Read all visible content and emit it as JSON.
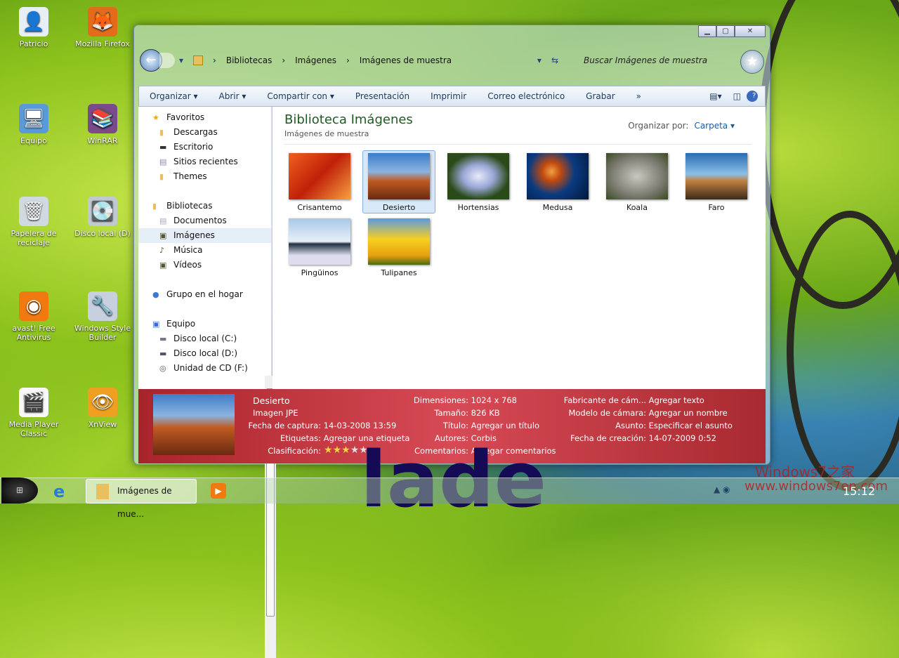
{
  "desktop": {
    "icons": [
      {
        "label": "Patricio",
        "glyph": "👤",
        "bg": "#e8eef5"
      },
      {
        "label": "Mozilla Firefox",
        "glyph": "🦊",
        "bg": "#e46b1a"
      },
      {
        "label": "Equipo",
        "glyph": "🖥",
        "bg": "#5a9ad8"
      },
      {
        "label": "WinRAR",
        "glyph": "📚",
        "bg": "#7a4a8a"
      },
      {
        "label": "Papelera de reciclaje",
        "glyph": "🗑",
        "bg": "#d0d8e0"
      },
      {
        "label": "Disco local (D)",
        "glyph": "💽",
        "bg": "#c0c8d0"
      },
      {
        "label": "avast! Free Antivirus",
        "glyph": "◉",
        "bg": "#f07a10"
      },
      {
        "label": "Windows Style Builder",
        "glyph": "🔧",
        "bg": "#c8d0e0"
      },
      {
        "label": "Media Player Classic",
        "glyph": "🎬",
        "bg": "#f8f8f8"
      },
      {
        "label": "XnView",
        "glyph": "👁",
        "bg": "#f0a020"
      }
    ]
  },
  "window": {
    "caption_buttons": [
      "▁",
      "▢",
      "✕"
    ],
    "breadcrumb": [
      "Bibliotecas",
      "Imágenes",
      "Imágenes de muestra"
    ],
    "search_placeholder": "Buscar Imágenes de muestra",
    "toolbar": [
      "Organizar ▾",
      "Abrir ▾",
      "Compartir con ▾",
      "Presentación",
      "Imprimir",
      "Correo electrónico",
      "Grabar",
      "»"
    ],
    "nav": [
      {
        "label": "Favoritos",
        "h": true,
        "icon": "★",
        "color": "#e8a820"
      },
      {
        "label": "Descargas",
        "icon": "▮",
        "color": "#e8c060"
      },
      {
        "label": "Escritorio",
        "icon": "▬",
        "color": "#333"
      },
      {
        "label": "Sitios recientes",
        "icon": "▤",
        "color": "#88a"
      },
      {
        "label": "Themes",
        "icon": "▮",
        "color": "#e8c060"
      },
      {
        "label": "",
        "spacer": true
      },
      {
        "label": "Bibliotecas",
        "h": true,
        "icon": "▮",
        "color": "#e8c060"
      },
      {
        "label": "Documentos",
        "icon": "▤",
        "color": "#aab"
      },
      {
        "label": "Imágenes",
        "icon": "▣",
        "color": "#553",
        "sel": true
      },
      {
        "label": "Música",
        "icon": "♪",
        "color": "#553"
      },
      {
        "label": "Vídeos",
        "icon": "▣",
        "color": "#553"
      },
      {
        "label": "",
        "spacer": true
      },
      {
        "label": "Grupo en el hogar",
        "h": true,
        "icon": "●",
        "color": "#3a7ad0"
      },
      {
        "label": "",
        "spacer": true
      },
      {
        "label": "Equipo",
        "h": true,
        "icon": "▣",
        "color": "#3a6ad0"
      },
      {
        "label": "Disco local (C:)",
        "icon": "▬",
        "color": "#778"
      },
      {
        "label": "Disco local (D:)",
        "icon": "▬",
        "color": "#556"
      },
      {
        "label": "Unidad de CD (F:)",
        "icon": "◎",
        "color": "#556"
      }
    ],
    "library_title": "Biblioteca Imágenes",
    "library_subtitle": "Imágenes de muestra",
    "arrange_label": "Organizar por:",
    "arrange_value": "Carpeta ▾",
    "items": [
      {
        "name": "Crisantemo",
        "bg": "linear-gradient(135deg,#f06020,#c02008,#f8a040)"
      },
      {
        "name": "Desierto",
        "bg": "linear-gradient(#3e7bc8,#8ab4e0 40%,#c05a22 60%,#6a2a10)",
        "selected": true
      },
      {
        "name": "Hortensias",
        "bg": "radial-gradient(#e8eaf8,#9aa8d8 35%,#2a4a18 70%)"
      },
      {
        "name": "Medusa",
        "bg": "radial-gradient(circle at 40% 40%,#f0a040,#c04a10 20%,#0a3a80 50%,#04183a)"
      },
      {
        "name": "Koala",
        "bg": "radial-gradient(#c8c8c0,#7a7a70 60%,#3a4a20)"
      },
      {
        "name": "Faro",
        "bg": "linear-gradient(#2a6ab0,#8ac0e8 45%,#c08040 60%,#3a2a1a)"
      },
      {
        "name": "Pingüinos",
        "bg": "linear-gradient(#a8c8e8,#e8f0f8 50%,#203040 55%,#dde 80%)"
      },
      {
        "name": "Tulipanes",
        "bg": "linear-gradient(#5a9ae0,#f8d020 45%,#e8a010 80%,#4a6a10)"
      }
    ],
    "details": {
      "name": "Desierto",
      "type": "Imagen JPE",
      "col1": [
        [
          "Fecha de captura:",
          "14-03-2008 13:59"
        ],
        [
          "Etiquetas:",
          "Agregar una etiqueta"
        ],
        [
          "Clasificación:",
          ""
        ]
      ],
      "rating": 3,
      "rating_max": 5,
      "col2": [
        [
          "Dimensiones:",
          "1024 x 768"
        ],
        [
          "Tamaño:",
          "826 KB"
        ],
        [
          "Título:",
          "Agregar un título"
        ],
        [
          "Autores:",
          "Corbis"
        ],
        [
          "Comentarios:",
          "Agregar comentarios"
        ]
      ],
      "col3": [
        [
          "Fabricante de cám...",
          "Agregar texto"
        ],
        [
          "Modelo de cámara:",
          "Agregar un nombre"
        ],
        [
          "Asunto:",
          "Especificar el asunto"
        ],
        [
          "Fecha de creación:",
          "14-07-2009 0:52"
        ]
      ]
    }
  },
  "taskbar": {
    "task_label": "Imágenes de mue...",
    "clock": "15:12"
  },
  "overlay": {
    "text": "lade",
    "watermark1": "Windows7之家",
    "watermark2": "www.windows7en.com"
  }
}
